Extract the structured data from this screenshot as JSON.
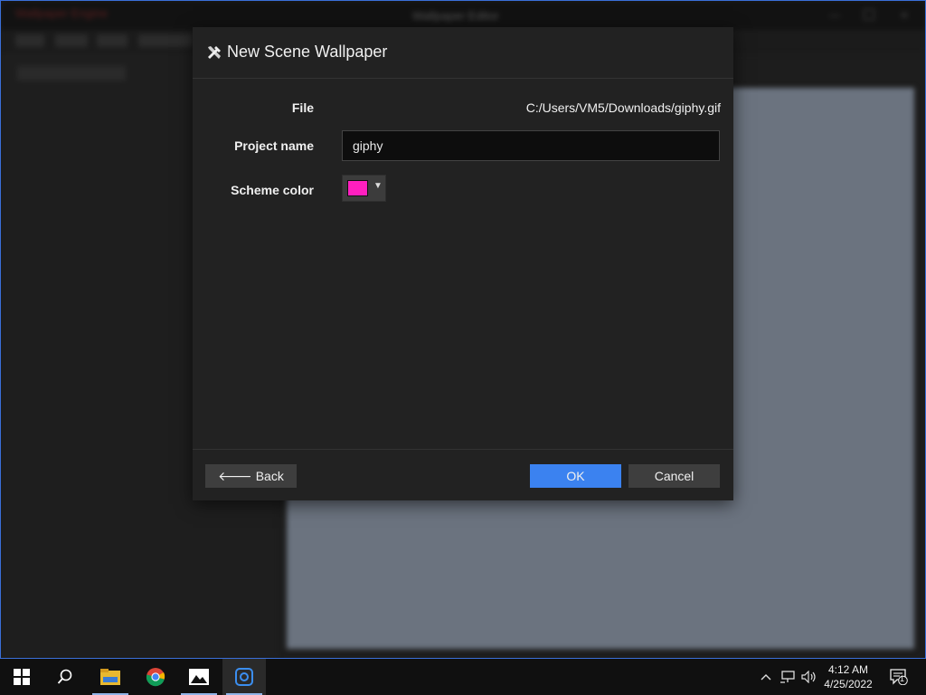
{
  "background_app": {
    "title": "Wallpaper Editor",
    "app_name": "Wallpaper Engine",
    "sidebar_item": "Imported Files"
  },
  "dialog": {
    "title": "New Scene Wallpaper",
    "file_label": "File",
    "file_value": "C:/Users/VM5/Downloads/giphy.gif",
    "project_name_label": "Project name",
    "project_name_value": "giphy",
    "scheme_color_label": "Scheme color",
    "scheme_color_value": "#ff1fbf",
    "back_label": "Back",
    "ok_label": "OK",
    "cancel_label": "Cancel"
  },
  "taskbar": {
    "apps": [
      "start",
      "search",
      "file-explorer",
      "chrome",
      "photos",
      "wallpaper-engine"
    ],
    "time": "4:12 AM",
    "date": "4/25/2022",
    "notification_count": "1"
  }
}
